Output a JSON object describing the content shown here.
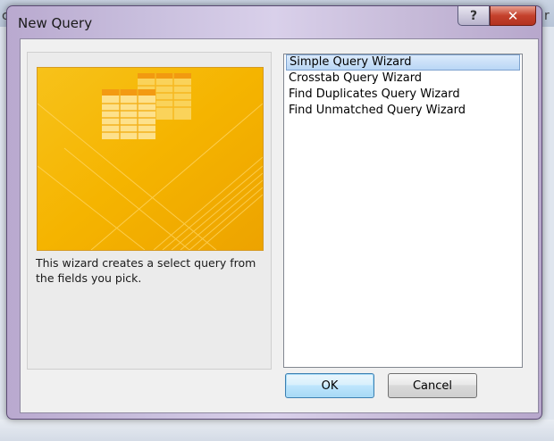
{
  "window": {
    "title": "New Query",
    "help_glyph": "?",
    "close_glyph": "✕"
  },
  "background": {
    "left_fragment": "c",
    "right_fragment": "r"
  },
  "description": "This wizard creates a select query from the fields you pick.",
  "wizards": [
    {
      "label": "Simple Query Wizard",
      "selected": true
    },
    {
      "label": "Crosstab Query Wizard",
      "selected": false
    },
    {
      "label": "Find Duplicates Query Wizard",
      "selected": false
    },
    {
      "label": "Find Unmatched Query Wizard",
      "selected": false
    }
  ],
  "buttons": {
    "ok_label": "OK",
    "cancel_label": "Cancel"
  },
  "colors": {
    "preview_gold": "#f5b400",
    "selection": "#cce4f7"
  }
}
